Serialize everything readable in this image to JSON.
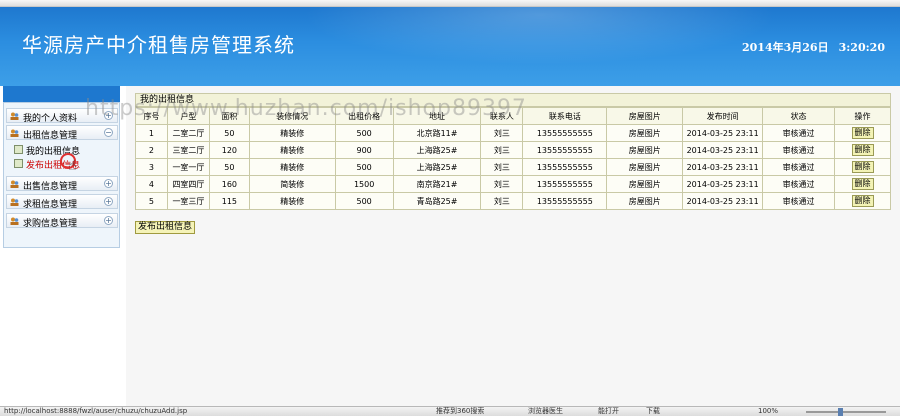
{
  "header": {
    "title": "华源房产中介租售房管理系统",
    "date": "2014年3月26日",
    "time": "3:20:20"
  },
  "sidebar": {
    "groups": [
      {
        "label": "我的个人资料",
        "toggle": "+"
      },
      {
        "label": "出租信息管理",
        "toggle": "−"
      },
      {
        "label": "出售信息管理",
        "toggle": "+"
      },
      {
        "label": "求租信息管理",
        "toggle": "+"
      },
      {
        "label": "求购信息管理",
        "toggle": "+"
      }
    ],
    "subitems": [
      {
        "label": "我的出租信息"
      },
      {
        "label": "发布出租信息"
      }
    ]
  },
  "main": {
    "section_title": "我的出租信息",
    "columns": [
      "序号",
      "户型",
      "面积",
      "装修情况",
      "出租价格",
      "地址",
      "联系人",
      "联系电话",
      "房屋图片",
      "发布时间",
      "状态",
      "操作"
    ],
    "rows": [
      {
        "no": "1",
        "layout": "二室二厅",
        "area": "50",
        "decor": "精装修",
        "price": "500",
        "address": "北京路11#",
        "contact": "刘三",
        "phone": "13555555555",
        "photo": "房屋图片",
        "time": "2014-03-25 23:11",
        "status": "审核通过",
        "action": "删除"
      },
      {
        "no": "2",
        "layout": "三室二厅",
        "area": "120",
        "decor": "精装修",
        "price": "900",
        "address": "上海路25#",
        "contact": "刘三",
        "phone": "13555555555",
        "photo": "房屋图片",
        "time": "2014-03-25 23:11",
        "status": "审核通过",
        "action": "删除"
      },
      {
        "no": "3",
        "layout": "一室一厅",
        "area": "50",
        "decor": "精装修",
        "price": "500",
        "address": "上海路25#",
        "contact": "刘三",
        "phone": "13555555555",
        "photo": "房屋图片",
        "time": "2014-03-25 23:11",
        "status": "审核通过",
        "action": "删除"
      },
      {
        "no": "4",
        "layout": "四室四厅",
        "area": "160",
        "decor": "简装修",
        "price": "1500",
        "address": "南京路21#",
        "contact": "刘三",
        "phone": "13555555555",
        "photo": "房屋图片",
        "time": "2014-03-25 23:11",
        "status": "审核通过",
        "action": "删除"
      },
      {
        "no": "5",
        "layout": "一室三厅",
        "area": "115",
        "decor": "精装修",
        "price": "500",
        "address": "青岛路25#",
        "contact": "刘三",
        "phone": "13555555555",
        "photo": "房屋图片",
        "time": "2014-03-25 23:11",
        "status": "审核通过",
        "action": "删除"
      }
    ],
    "add_button": "发布出租信息"
  },
  "watermark": "https://www.huzhan.com/ishop89397",
  "status_bar": {
    "url": "http://localhost:8888/fwzl/auser/chuzu/chuzuAdd.jsp",
    "items": [
      "推荐到360搜索",
      "浏览器医生",
      "能打开",
      "下载",
      "100%"
    ]
  },
  "colors": {
    "header_blue": "#1e78cf",
    "active_item": "#cc0000",
    "table_border": "#c9c9a6"
  }
}
